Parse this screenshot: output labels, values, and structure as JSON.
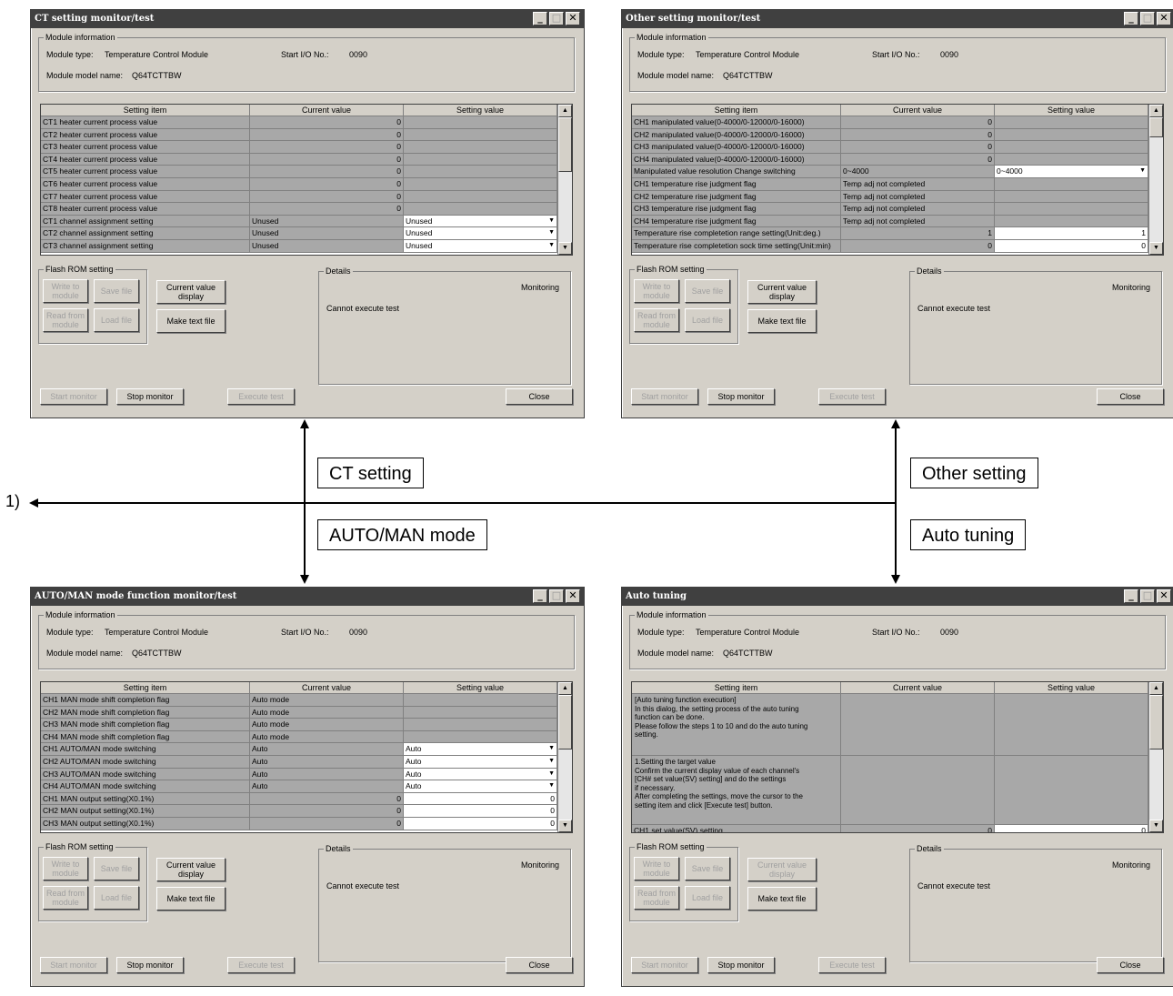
{
  "common": {
    "module_info_legend": "Module information",
    "module_type_label": "Module type:",
    "module_type_value": "Temperature Control Module",
    "start_io_label": "Start I/O No.:",
    "start_io_value": "0090",
    "model_name_label": "Module model name:",
    "model_name_value": "Q64TCTTBW",
    "col_setting_item": "Setting item",
    "col_current_value": "Current value",
    "col_setting_value": "Setting value",
    "flash_legend": "Flash ROM setting",
    "btn_write": "Write to module",
    "btn_save": "Save file",
    "btn_read": "Read from module",
    "btn_load": "Load file",
    "btn_current_display": "Current value display",
    "btn_make_text": "Make text file",
    "details_legend": "Details",
    "monitoring": "Monitoring",
    "cannot_execute": "Cannot execute test",
    "btn_start_monitor": "Start monitor",
    "btn_stop_monitor": "Stop monitor",
    "btn_execute_test": "Execute test",
    "btn_close": "Close"
  },
  "ct_window": {
    "title": "CT setting monitor/test",
    "rows": [
      {
        "item": "CT1 heater current process value",
        "current": "0",
        "setting": ""
      },
      {
        "item": "CT2 heater current process value",
        "current": "0",
        "setting": ""
      },
      {
        "item": "CT3 heater current process value",
        "current": "0",
        "setting": ""
      },
      {
        "item": "CT4 heater current process value",
        "current": "0",
        "setting": ""
      },
      {
        "item": "CT5 heater current process value",
        "current": "0",
        "setting": ""
      },
      {
        "item": "CT6 heater current process value",
        "current": "0",
        "setting": ""
      },
      {
        "item": "CT7 heater current process value",
        "current": "0",
        "setting": ""
      },
      {
        "item": "CT8 heater current process value",
        "current": "0",
        "setting": ""
      },
      {
        "item": "CT1 channel assignment setting",
        "current": "Unused",
        "setting": "Unused"
      },
      {
        "item": "CT2 channel assignment setting",
        "current": "Unused",
        "setting": "Unused"
      },
      {
        "item": "CT3 channel assignment setting",
        "current": "Unused",
        "setting": "Unused"
      }
    ]
  },
  "other_window": {
    "title": "Other setting monitor/test",
    "rows": [
      {
        "item": "CH1 manipulated value(0-4000/0-12000/0-16000)",
        "current": "0",
        "setting": ""
      },
      {
        "item": "CH2 manipulated value(0-4000/0-12000/0-16000)",
        "current": "0",
        "setting": ""
      },
      {
        "item": "CH3 manipulated value(0-4000/0-12000/0-16000)",
        "current": "0",
        "setting": ""
      },
      {
        "item": "CH4 manipulated value(0-4000/0-12000/0-16000)",
        "current": "0",
        "setting": ""
      },
      {
        "item": "Manipulated value resolution Change switching",
        "current": "0~4000",
        "setting": "0~4000"
      },
      {
        "item": "CH1 temperature rise judgment flag",
        "current": "Temp adj not completed",
        "setting": ""
      },
      {
        "item": "CH2 temperature rise judgment flag",
        "current": "Temp adj not completed",
        "setting": ""
      },
      {
        "item": "CH3 temperature rise judgment flag",
        "current": "Temp adj not completed",
        "setting": ""
      },
      {
        "item": "CH4 temperature rise judgment flag",
        "current": "Temp adj not completed",
        "setting": ""
      },
      {
        "item": "Temperature rise completetion range setting(Unit:deg.)",
        "current": "1",
        "setting": "1"
      },
      {
        "item": "Temperature rise completetion sock time setting(Unit:min)",
        "current": "0",
        "setting": "0"
      }
    ]
  },
  "auto_man_window": {
    "title": "AUTO/MAN mode function monitor/test",
    "rows": [
      {
        "item": "CH1 MAN mode shift completion flag",
        "current": "Auto mode",
        "setting": ""
      },
      {
        "item": "CH2 MAN mode shift completion flag",
        "current": "Auto mode",
        "setting": ""
      },
      {
        "item": "CH3 MAN mode shift completion flag",
        "current": "Auto mode",
        "setting": ""
      },
      {
        "item": "CH4 MAN mode shift completion flag",
        "current": "Auto mode",
        "setting": ""
      },
      {
        "item": "CH1 AUTO/MAN mode switching",
        "current": "Auto",
        "setting": "Auto"
      },
      {
        "item": "CH2 AUTO/MAN mode switching",
        "current": "Auto",
        "setting": "Auto"
      },
      {
        "item": "CH3 AUTO/MAN mode switching",
        "current": "Auto",
        "setting": "Auto"
      },
      {
        "item": "CH4 AUTO/MAN mode switching",
        "current": "Auto",
        "setting": "Auto"
      },
      {
        "item": "CH1 MAN output setting(X0.1%)",
        "current": "0",
        "setting": "0"
      },
      {
        "item": "CH2 MAN output setting(X0.1%)",
        "current": "0",
        "setting": "0"
      },
      {
        "item": "CH3 MAN output setting(X0.1%)",
        "current": "0",
        "setting": "0"
      }
    ]
  },
  "auto_tuning_window": {
    "title": "Auto tuning",
    "note1": "[Auto tuning function execution]\n  In this dialog, the setting process of the auto tuning\n  function can be done.\n  Please follow the steps 1 to 10 and do the auto tuning\n  setting.",
    "note2": "1.Setting the target value\n  Confirm the current display value of each channel's\n  [CH# set value(SV) setting] and do the settings\n  if necessary.\n  After completing the settings, move the cursor to the\n  setting item and click [Execute test] button.",
    "partial_row": "CH1 set value(SV) setting",
    "partial_current": "0",
    "partial_setting": "0"
  },
  "diagram": {
    "ct_label": "CT setting",
    "other_label": "Other setting",
    "automan_label": "AUTO/MAN mode",
    "autotuning_label": "Auto tuning",
    "ref_label": "1)"
  }
}
